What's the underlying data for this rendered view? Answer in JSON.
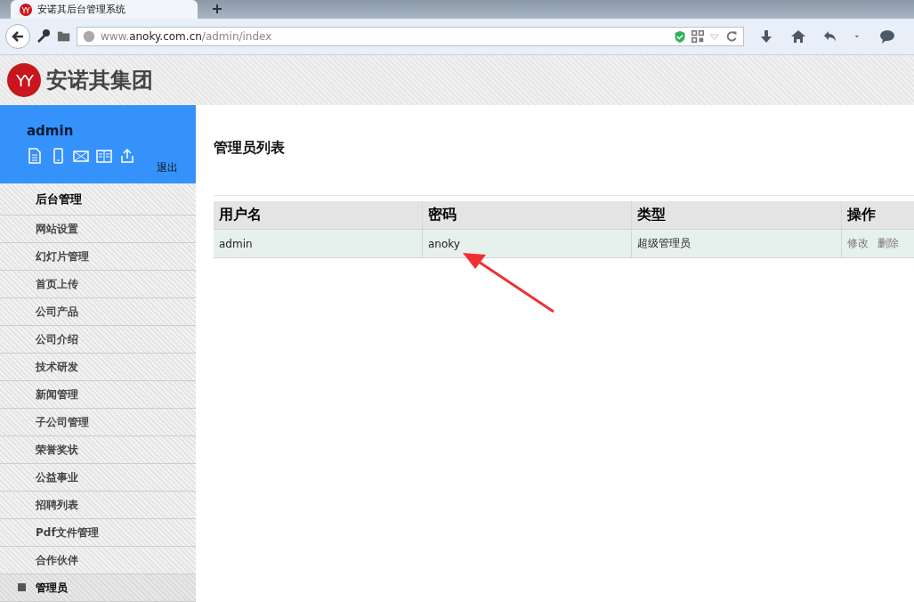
{
  "browser": {
    "tab_title": "安诺其后台管理系统",
    "url": "www.**anoky.com.cn**/admin/index"
  },
  "header": {
    "brand": "安诺其集团",
    "logo_text": "YY"
  },
  "user_panel": {
    "username": "admin",
    "logout": "退出"
  },
  "sidebar": {
    "title": "后台管理",
    "items": [
      {
        "label": "网站设置",
        "selected": false
      },
      {
        "label": "幻灯片管理",
        "selected": false
      },
      {
        "label": "首页上传",
        "selected": false
      },
      {
        "label": "公司产品",
        "selected": false
      },
      {
        "label": "公司介绍",
        "selected": false
      },
      {
        "label": "技术研发",
        "selected": false
      },
      {
        "label": "新闻管理",
        "selected": false
      },
      {
        "label": "子公司管理",
        "selected": false
      },
      {
        "label": "荣誉奖状",
        "selected": false
      },
      {
        "label": "公益事业",
        "selected": false
      },
      {
        "label": "招聘列表",
        "selected": false
      },
      {
        "label": "Pdf文件管理",
        "selected": false
      },
      {
        "label": "合作伙伴",
        "selected": false
      },
      {
        "label": "管理员",
        "selected": true
      }
    ]
  },
  "page_title": "管理员列表",
  "table": {
    "columns": [
      "用户名",
      "密码",
      "类型",
      "操作"
    ],
    "rows": [
      {
        "cells": [
          "admin",
          "anoky",
          "超级管理员"
        ],
        "actions": [
          "修改",
          "删除"
        ]
      }
    ]
  }
}
